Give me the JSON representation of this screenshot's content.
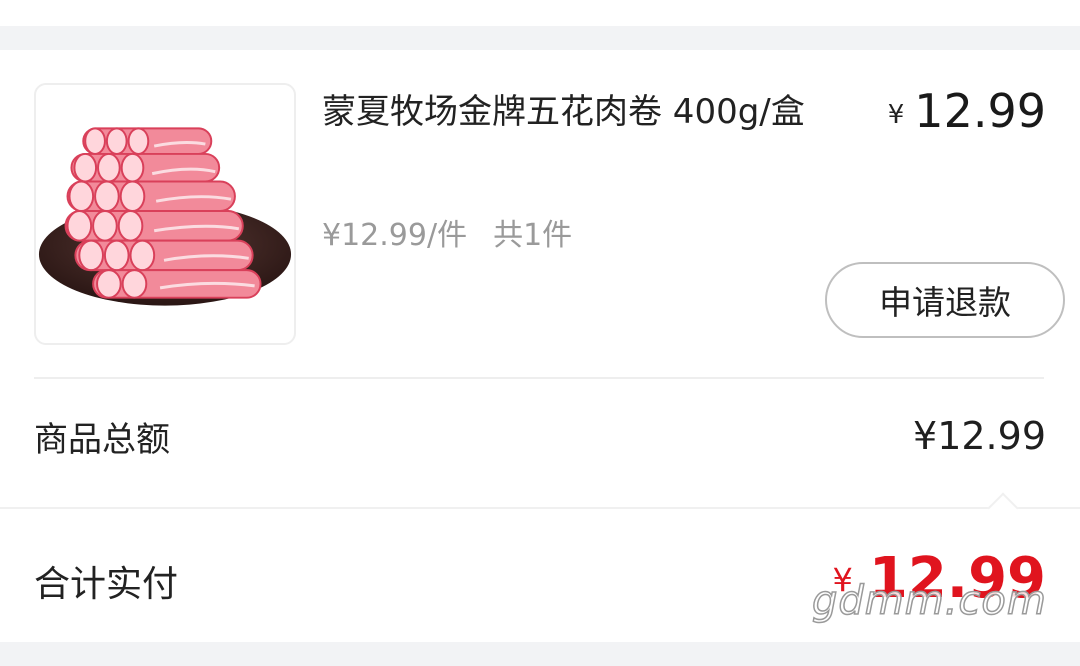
{
  "product": {
    "title": "蒙夏牧场金牌五花肉卷 400g/盒",
    "price_symbol": "¥",
    "price_value": "12.99",
    "unit_price": "¥12.99/件",
    "quantity": "共1件",
    "image_icon": "meat-rolls-photo"
  },
  "actions": {
    "refund_label": "申请退款"
  },
  "summary": {
    "subtotal_label": "商品总额",
    "subtotal_value": "¥12.99",
    "total_label": "合计实付",
    "total_symbol": "¥",
    "total_value": "12.99"
  },
  "watermark": "gdmm.com",
  "colors": {
    "accent_red": "#e0141e",
    "muted_text": "#9a9a9a",
    "background": "#f2f3f5"
  }
}
